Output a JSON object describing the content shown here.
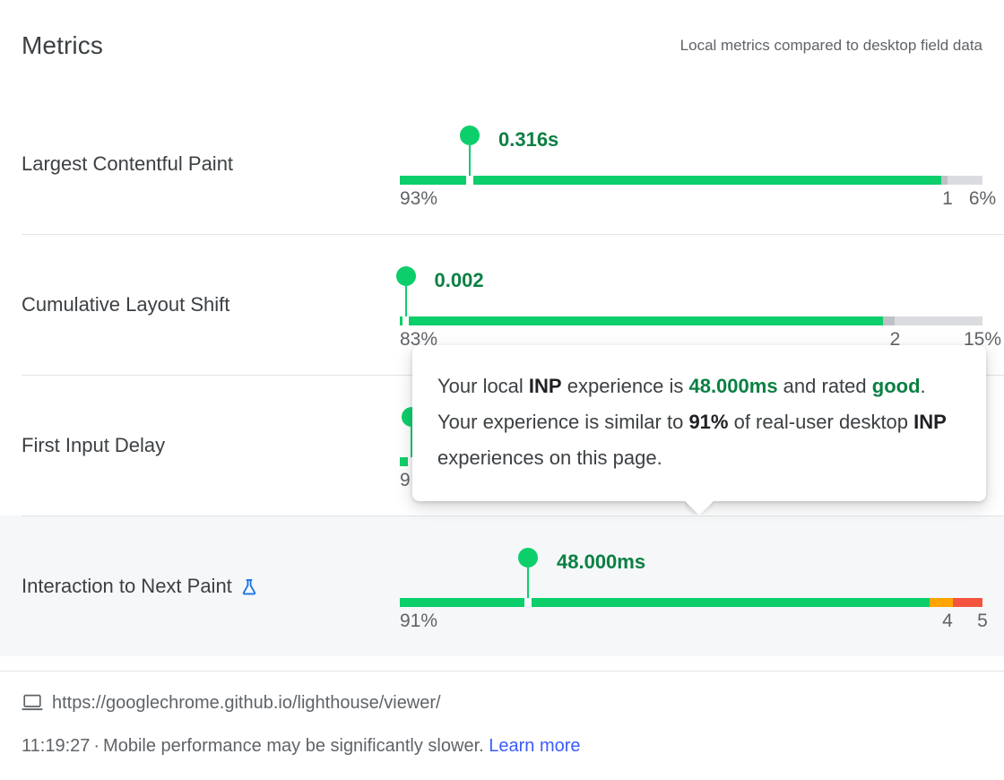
{
  "header": {
    "title": "Metrics",
    "subtitle": "Local metrics compared to desktop field data"
  },
  "colors": {
    "good": "#0cce6b",
    "good_text": "#0b8043",
    "average": "#ffa400",
    "poor": "#f4543f",
    "gray_mid": "#bdc1c6",
    "gray_late": "#dadce0",
    "link": "#3b5bfd",
    "row_highlight": "#f5f7f9"
  },
  "metrics": [
    {
      "name": "Largest Contentful Paint",
      "experimental": false,
      "highlighted": false,
      "value": "0.316s",
      "marker_percent": 12,
      "segments": [
        {
          "kind": "good",
          "percent": 93
        },
        {
          "kind": "gray-mid",
          "percent": 1
        },
        {
          "kind": "gray-late",
          "percent": 6
        }
      ],
      "labels": [
        {
          "text": "93%",
          "align": "left",
          "percent": 0
        },
        {
          "text": "1",
          "align": "right",
          "percent": 94
        },
        {
          "text": "6%",
          "align": "right",
          "percent": 100
        }
      ]
    },
    {
      "name": "Cumulative Layout Shift",
      "experimental": false,
      "highlighted": false,
      "value": "0.002",
      "marker_percent": 1,
      "segments": [
        {
          "kind": "good",
          "percent": 83
        },
        {
          "kind": "gray-mid",
          "percent": 2
        },
        {
          "kind": "gray-late",
          "percent": 15
        }
      ],
      "labels": [
        {
          "text": "83%",
          "align": "left",
          "percent": 0
        },
        {
          "text": "2",
          "align": "right",
          "percent": 85
        },
        {
          "text": "15%",
          "align": "right",
          "percent": 100
        }
      ]
    },
    {
      "name": "First Input Delay",
      "experimental": false,
      "highlighted": false,
      "value": "",
      "marker_percent": 2,
      "segments": [
        {
          "kind": "good",
          "percent": 96
        },
        {
          "kind": "gray-mid",
          "percent": 2
        },
        {
          "kind": "gray-late",
          "percent": 2
        }
      ],
      "labels": [
        {
          "text": "9",
          "align": "left",
          "percent": 0
        }
      ]
    },
    {
      "name": "Interaction to Next Paint",
      "experimental": true,
      "highlighted": true,
      "value": "48.000ms",
      "marker_percent": 22,
      "segments": [
        {
          "kind": "good",
          "percent": 91
        },
        {
          "kind": "average",
          "percent": 4
        },
        {
          "kind": "poor",
          "percent": 5
        }
      ],
      "labels": [
        {
          "text": "91%",
          "align": "left",
          "percent": 0
        },
        {
          "text": "4",
          "align": "right",
          "percent": 94
        },
        {
          "text": "5",
          "align": "right",
          "percent": 100
        }
      ]
    }
  ],
  "tooltip": {
    "prefix": "Your local ",
    "metric_abbr_1": "INP",
    "mid_1": " experience is ",
    "value": "48.000ms",
    "mid_2": " and rated ",
    "rating": "good",
    "mid_3": ". Your experience is similar to ",
    "percentile": "91%",
    "mid_4": " of real-user desktop ",
    "metric_abbr_2": "INP",
    "suffix": " experiences on this page."
  },
  "footer": {
    "url": "https://googlechrome.github.io/lighthouse/viewer/",
    "time": "11:19:27",
    "separator": "·",
    "note": "Mobile performance may be significantly slower.",
    "link": "Learn more"
  }
}
